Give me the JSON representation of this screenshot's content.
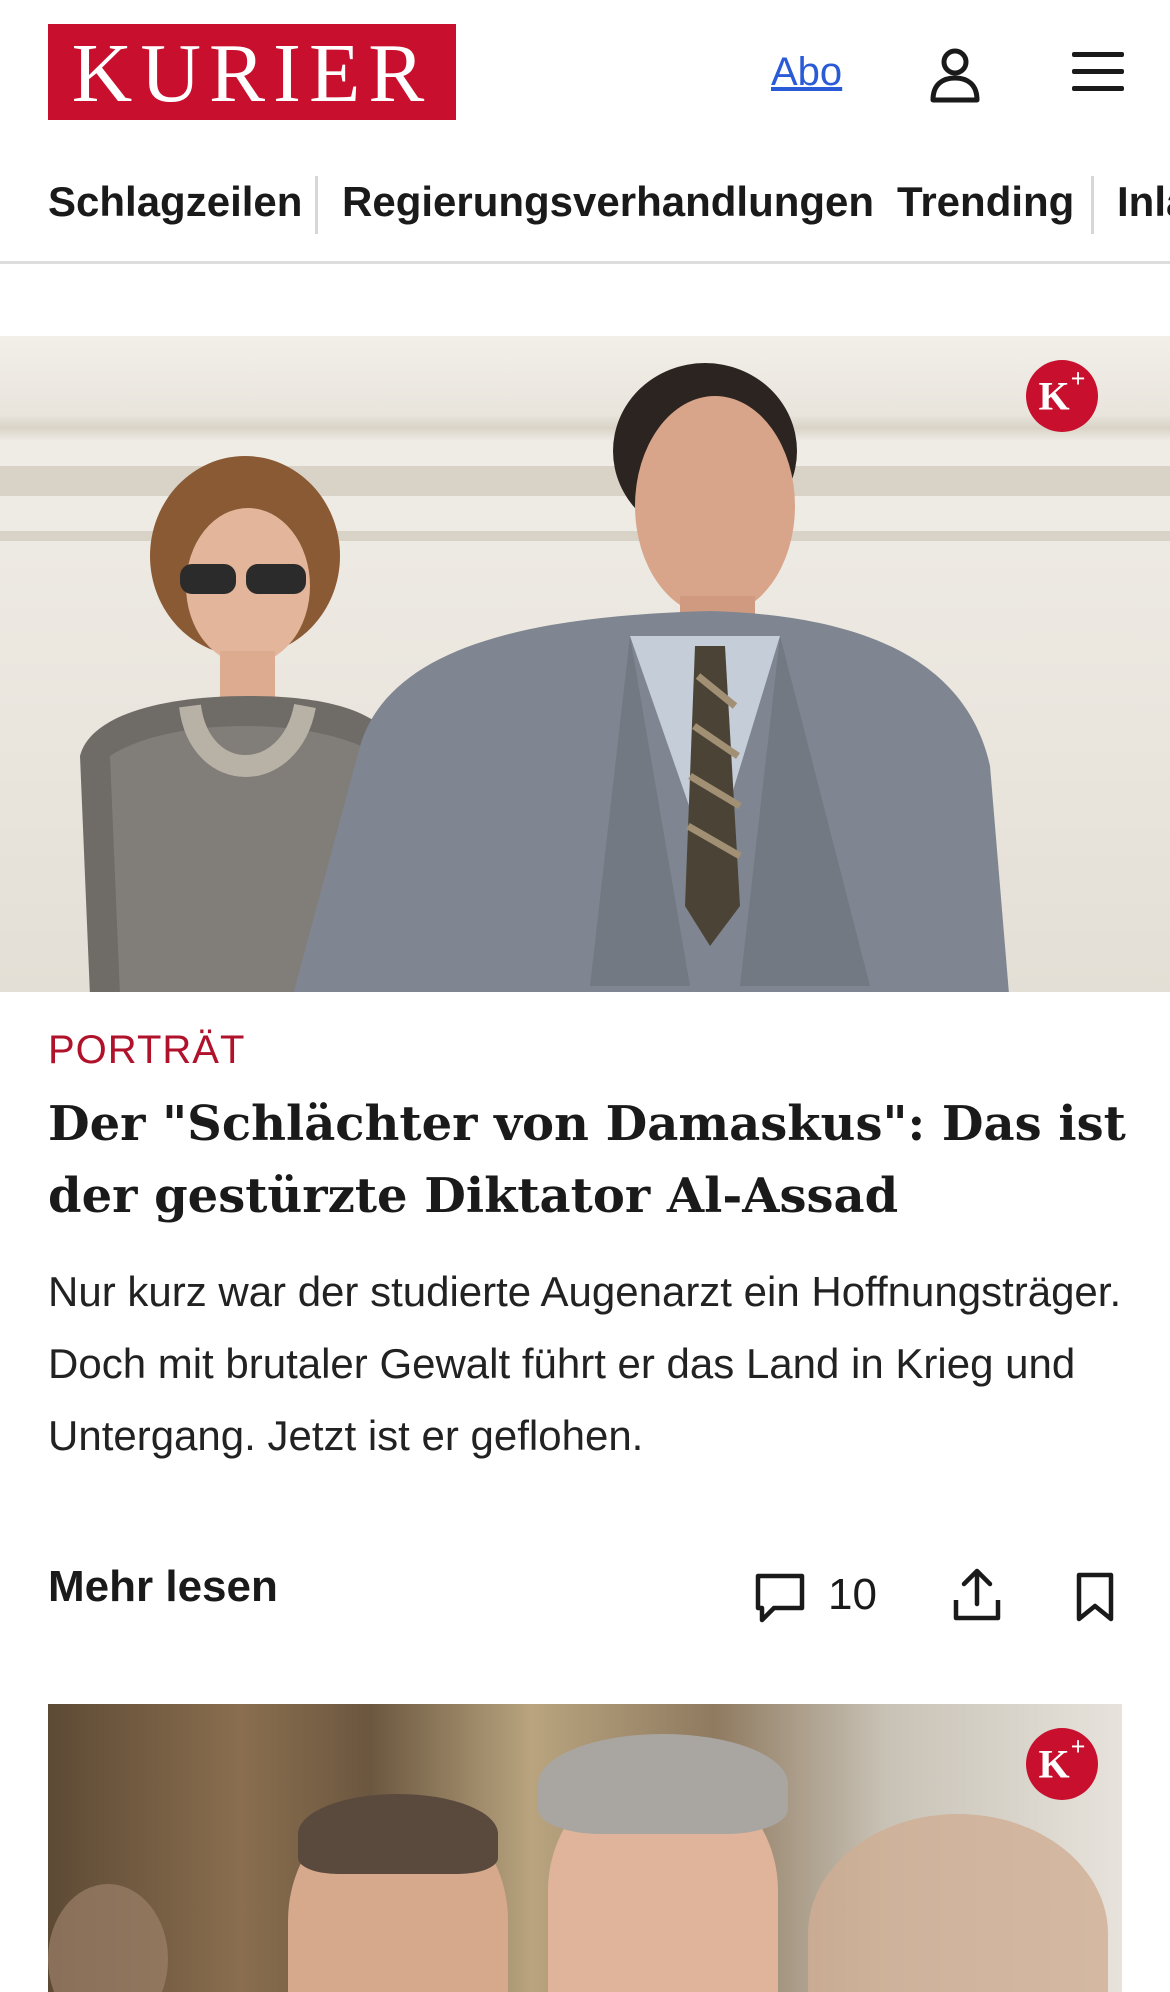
{
  "header": {
    "logo_text": "KURIER",
    "abo_label": "Abo",
    "icons": {
      "account": "user-icon",
      "menu": "hamburger-menu-icon"
    }
  },
  "nav": {
    "items": [
      {
        "label": "Schlagzeilen"
      },
      {
        "label": "Regierungsverhandlungen"
      },
      {
        "label": "Trending"
      },
      {
        "label": "Inland"
      }
    ]
  },
  "articles": [
    {
      "badge": "K+",
      "kicker": "PORTRÄT",
      "title": "Der \"Schlächter von Damaskus\": Das ist der gestürzte Diktator Al-Assad",
      "teaser": "Nur kurz war der studierte Augenarzt ein Hoffnungsträger. Doch mit brutaler Gewalt führt er das Land in Krieg und Untergang. Jetzt ist er geflohen.",
      "read_more": "Mehr lesen",
      "comment_count": "10",
      "icons": {
        "comments": "comment-icon",
        "share": "share-icon",
        "bookmark": "bookmark-icon"
      }
    },
    {
      "badge": "K+"
    }
  ],
  "colors": {
    "brand_red": "#c8102e",
    "kicker_red": "#b0122b",
    "link_blue": "#2a5bd7"
  }
}
